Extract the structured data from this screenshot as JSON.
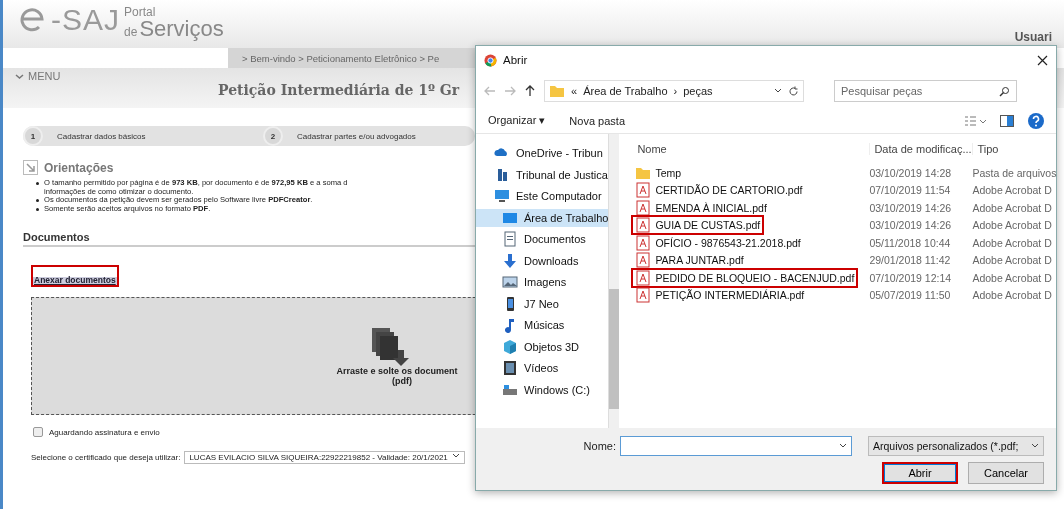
{
  "portal": {
    "logo_text": "-SAJ",
    "logo_sub_top": "Portal",
    "logo_sub_small": "de",
    "logo_sub_main": "Serviços",
    "user": "Usuari"
  },
  "breadcrumb": "> Bem-vindo > Peticionamento Eletrônico > Pe",
  "menu": {
    "label": "MENU"
  },
  "page_title": "Petição Intermediária de 1º Gr",
  "steps": [
    {
      "number": "1",
      "label": "Cadastrar dados básicos"
    },
    {
      "number": "2",
      "label": "Cadastrar partes e/ou advogados"
    }
  ],
  "guidelines": {
    "title": "Orientações",
    "items": [
      {
        "lines": [
          "O tamanho permitido por página é de **973 KB**, por documento é de **972,95 KB** e a soma d",
          "informações de como otimizar o documento."
        ]
      },
      {
        "lines": [
          "Os documentos da petição devem ser gerados pelo Software livre **PDFCreator**."
        ]
      },
      {
        "lines": [
          "Somente serão aceitos arquivos no formato **PDF**."
        ]
      }
    ]
  },
  "documents": {
    "title": "Documentos",
    "attach_button": {
      "label": "Anexar documentos",
      "highlighted": true
    },
    "dropzone": {
      "text": "Arraste e solte os document",
      "subtext": "(pdf)"
    }
  },
  "pending_checkbox": {
    "label": "Aguardando assinatura e envio",
    "checked": false
  },
  "certificate": {
    "label": "Selecione o certificado que deseja utilizar:",
    "value": "LUCAS EVILACIO SILVA SIQUEIRA:22922219852 - Validade: 20/1/2021"
  },
  "dialog": {
    "title": "Abrir",
    "path": [
      {
        "label": "«"
      },
      {
        "label": "Área de Trabalho"
      },
      {
        "label": "›"
      },
      {
        "label": "peças"
      }
    ],
    "search": {
      "placeholder": "Pesquisar peças"
    },
    "toolbar": [
      "Organizar ▾",
      "Nova pasta"
    ],
    "nav": [
      {
        "label": "OneDrive - Tribun",
        "kind": "cloud",
        "selected": false
      },
      {
        "label": "Tribunal de Justica",
        "kind": "building",
        "selected": false
      },
      {
        "label": "Este Computador",
        "kind": "computer",
        "selected": false,
        "children": [
          {
            "label": "Área de Trabalho",
            "kind": "desktop",
            "selected": true
          },
          {
            "label": "Documentos",
            "kind": "document",
            "selected": false
          },
          {
            "label": "Downloads",
            "kind": "download",
            "selected": false
          },
          {
            "label": "Imagens",
            "kind": "image",
            "selected": false
          },
          {
            "label": "J7 Neo",
            "kind": "phone",
            "selected": false
          },
          {
            "label": "Músicas",
            "kind": "music",
            "selected": false
          },
          {
            "label": "Objetos 3D",
            "kind": "cube",
            "selected": false
          },
          {
            "label": "Vídeos",
            "kind": "video",
            "selected": false
          },
          {
            "label": "Windows (C:)",
            "kind": "drive",
            "selected": false
          }
        ]
      }
    ],
    "columns": [
      "Nome",
      "Data de modificaç...",
      "Tipo"
    ],
    "files": [
      {
        "name": "Temp",
        "kind": "folder",
        "date": "03/10/2019 14:28",
        "type": "Pasta de arquivos",
        "highlighted": false
      },
      {
        "name": "CERTIDÃO DE CARTORIO.pdf",
        "kind": "pdf",
        "date": "07/10/2019 11:54",
        "type": "Adobe Acrobat D",
        "highlighted": false
      },
      {
        "name": "EMENDA À INICIAL.pdf",
        "kind": "pdf",
        "date": "03/10/2019 14:26",
        "type": "Adobe Acrobat D",
        "highlighted": false
      },
      {
        "name": "GUIA DE CUSTAS.pdf",
        "kind": "pdf",
        "date": "03/10/2019 14:26",
        "type": "Adobe Acrobat D",
        "highlighted": true
      },
      {
        "name": "OFÍCIO - 9876543-21.2018.pdf",
        "kind": "pdf",
        "date": "05/11/2018 10:44",
        "type": "Adobe Acrobat D",
        "highlighted": false
      },
      {
        "name": "PARA JUNTAR.pdf",
        "kind": "pdf",
        "date": "29/01/2018 11:42",
        "type": "Adobe Acrobat D",
        "highlighted": false
      },
      {
        "name": "PEDIDO DE BLOQUEIO - BACENJUD.pdf",
        "kind": "pdf",
        "date": "07/10/2019 12:14",
        "type": "Adobe Acrobat D",
        "highlighted": true
      },
      {
        "name": "PETIÇÃO INTERMEDIÁRIA.pdf",
        "kind": "pdf",
        "date": "05/07/2019 11:50",
        "type": "Adobe Acrobat D",
        "highlighted": false
      }
    ],
    "name_label": "Nome:",
    "filter": "Arquivos personalizados (*.pdf;",
    "buttons": [
      {
        "label": "Abrir",
        "highlighted": true
      },
      {
        "label": "Cancelar",
        "highlighted": false
      }
    ]
  }
}
